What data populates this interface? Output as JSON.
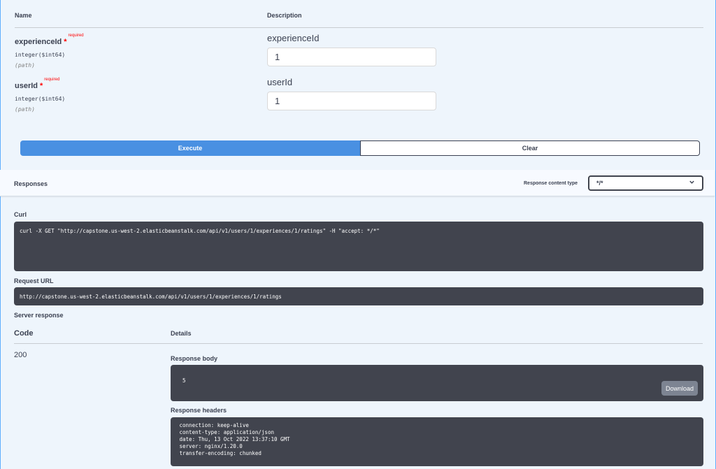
{
  "params": {
    "header_name": "Name",
    "header_description": "Description",
    "items": [
      {
        "name": "experienceId",
        "star": "*",
        "required": "required",
        "type": "integer($int64)",
        "location": "(path)",
        "label": "experienceId",
        "value": "1"
      },
      {
        "name": "userId",
        "star": "*",
        "required": "required",
        "type": "integer($int64)",
        "location": "(path)",
        "label": "userId",
        "value": "1"
      }
    ]
  },
  "buttons": {
    "execute": "Execute",
    "clear": "Clear"
  },
  "responses": {
    "title": "Responses",
    "content_type_label": "Response content type",
    "content_type_value": "*/*",
    "chevron_icon": "chevron-down-icon"
  },
  "curl": {
    "label": "Curl",
    "command": "curl -X GET \"http://capstone.us-west-2.elasticbeanstalk.com/api/v1/users/1/experiences/1/ratings\" -H \"accept: */*\""
  },
  "request_url": {
    "label": "Request URL",
    "value": "http://capstone.us-west-2.elasticbeanstalk.com/api/v1/users/1/experiences/1/ratings"
  },
  "server_response": {
    "label": "Server response",
    "code_header": "Code",
    "details_header": "Details",
    "code": "200",
    "body_label": "Response body",
    "body": "5",
    "download": "Download",
    "headers_label": "Response headers",
    "headers": " connection: keep-alive \n content-type: application/json \n date: Thu, 13 Oct 2022 13:37:10 GMT \n server: nginx/1.20.0 \n transfer-encoding: chunked "
  }
}
